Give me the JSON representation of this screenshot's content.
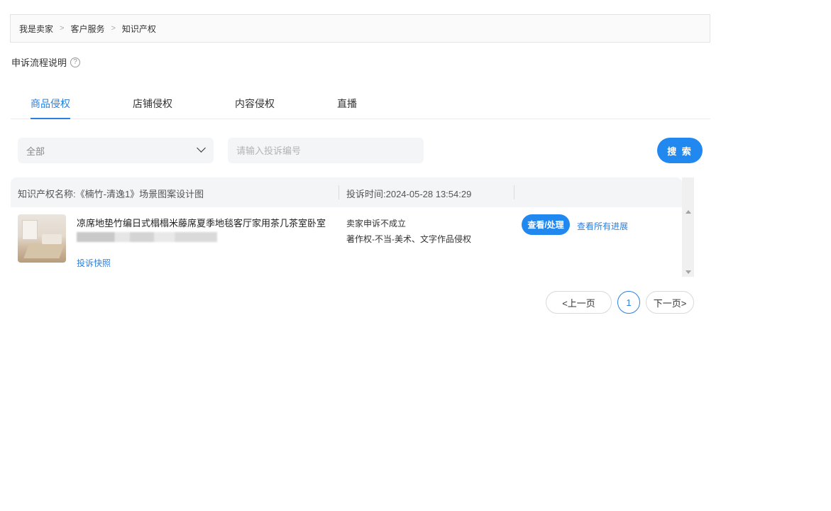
{
  "breadcrumb": {
    "items": [
      "我是卖家",
      "客户服务",
      "知识产权"
    ],
    "separator": ">"
  },
  "help": {
    "label": "申诉流程说明",
    "icon": "question-circle-icon"
  },
  "tabs": [
    {
      "label": "商品侵权",
      "active": true
    },
    {
      "label": "店铺侵权",
      "active": false
    },
    {
      "label": "内容侵权",
      "active": false
    },
    {
      "label": "直播",
      "active": false
    }
  ],
  "filters": {
    "select_value": "全部",
    "search_placeholder": "请输入投诉编号",
    "search_value": "",
    "search_button": "搜 索"
  },
  "table": {
    "header": {
      "ip_name": "知识产权名称:《楠竹-清逸1》场景图案设计图",
      "complaint_time": "投诉时间:2024-05-28 13:54:29"
    },
    "rows": [
      {
        "product_title": "凉席地垫竹编日式榻榻米藤席夏季地毯客厅家用茶几茶室卧室",
        "snapshot_link": "投诉快照",
        "status": "卖家申诉不成立",
        "reason": "著作权-不当-美术、文字作品侵权",
        "view_button": "查看/处理",
        "progress_link": "查看所有进展"
      }
    ]
  },
  "pagination": {
    "prev": "<上一页",
    "current_page": "1",
    "next": "下一页>"
  },
  "colors": {
    "accent": "#2188f0",
    "link": "#2b7fe0"
  }
}
